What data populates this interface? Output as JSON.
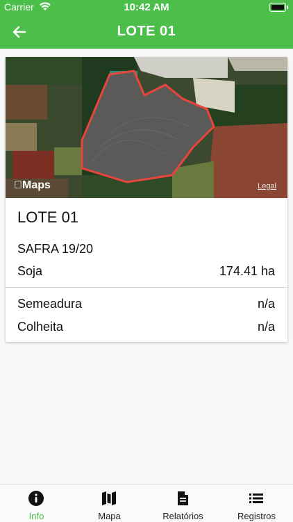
{
  "status_bar": {
    "carrier": "Carrier",
    "time": "10:42 AM"
  },
  "nav": {
    "title": "LOTE 01",
    "back_icon": "arrow-left-icon"
  },
  "map": {
    "logo_text": "Maps",
    "legal_text": "Legal",
    "boundary_color": "#e8453c"
  },
  "details": {
    "name": "LOTE 01",
    "season": "SAFRA 19/20",
    "crop": "Soja",
    "area": "174.41 ha",
    "sowing_label": "Semeadura",
    "sowing_value": "n/a",
    "harvest_label": "Colheita",
    "harvest_value": "n/a"
  },
  "tabs": [
    {
      "label": "Info",
      "icon": "info-icon",
      "active": true
    },
    {
      "label": "Mapa",
      "icon": "map-icon",
      "active": false
    },
    {
      "label": "Relatórios",
      "icon": "document-icon",
      "active": false
    },
    {
      "label": "Registros",
      "icon": "list-icon",
      "active": false
    }
  ],
  "colors": {
    "brand_green": "#4cbf4a"
  }
}
